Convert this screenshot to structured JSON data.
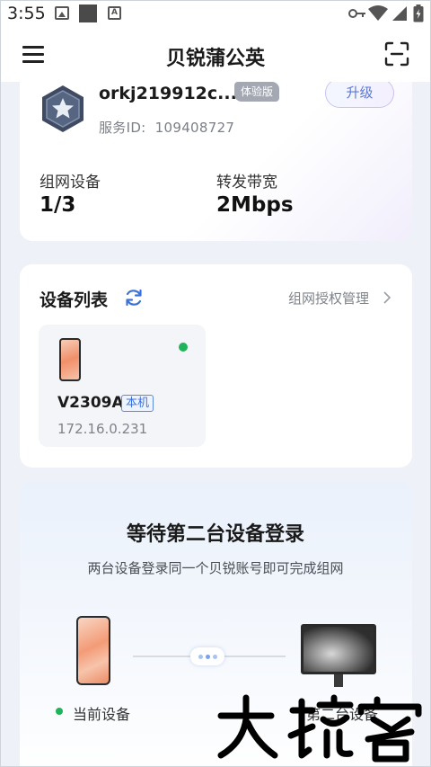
{
  "status_bar": {
    "time": "3:55",
    "left_icons": [
      "photo-icon",
      "square-icon",
      "a-icon"
    ],
    "right_icons": [
      "key-icon",
      "wifi-icon",
      "signal-icon",
      "battery-icon"
    ]
  },
  "app_bar": {
    "title": "贝锐蒲公英",
    "left_icon": "menu-icon",
    "right_icon": "scan-icon"
  },
  "account": {
    "name": "orkj219912c...",
    "plan_tag": "体验版",
    "upgrade_label": "升级",
    "service_id_label": "服务ID:",
    "service_id_value": "109408727",
    "stats": [
      {
        "label": "组网设备",
        "value": "1/3"
      },
      {
        "label": "转发带宽",
        "value": "2Mbps"
      }
    ]
  },
  "device_list": {
    "title": "设备列表",
    "auth_link": "组网授权管理",
    "devices": [
      {
        "name": "V2309A",
        "tag": "本机",
        "ip": "172.16.0.231",
        "online": true
      }
    ]
  },
  "waiting": {
    "title": "等待第二台设备登录",
    "subtitle": "两台设备登录同一个贝锐账号即可完成组网",
    "current_label": "当前设备",
    "second_label": "第二台设备"
  },
  "colors": {
    "accent": "#3c72d8",
    "online": "#1fb45a",
    "background": "#eef1f7"
  }
}
